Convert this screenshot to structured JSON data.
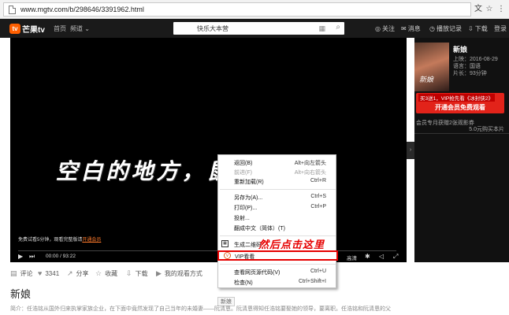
{
  "browser": {
    "url": "www.mgtv.com/b/298646/3391962.html"
  },
  "site": {
    "logo_text": "芒果tv",
    "logo_mark": "tv",
    "nav_home": "首页",
    "nav_channel": "频道",
    "search_value": "快乐大本营",
    "follow": "关注",
    "messages": "消息",
    "history": "播放记录",
    "download": "下载",
    "login": "登录"
  },
  "player": {
    "slogan": "空白的地方，鼠標右鍵！",
    "trial_text": "免费试看5分钟，观看完整版请",
    "trial_link": "开通会员",
    "time": "00:00 / 93:22",
    "quality": "高清"
  },
  "movie": {
    "poster_text": "新娘",
    "title": "新娘",
    "date": "上映：2016-08-29",
    "language": "语言：国语",
    "duration": "片长：93分钟",
    "promo_top": "买3送1，VIP抢先看《冰封侠2》",
    "promo_button": "开通会员免费观看",
    "vip_line": "会员专月获赠2张观影券",
    "price": "5.0元购买本片"
  },
  "toolbar": {
    "comment": "评论",
    "likes": "3341",
    "share": "分享",
    "favorite": "收藏",
    "download": "下载",
    "mode": "我的观看方式"
  },
  "page": {
    "title": "新娘",
    "intro": "简介：任浩铭从国外归来执掌家族企业，在下面中竟然发现了自己当年的未婚妻——阮清恩。阮清恩得知任浩铭要娶她的领导，要离职。任浩铭和阮清恩的父",
    "tag": "新娘"
  },
  "context_menu": {
    "items": [
      {
        "label": "返回(B)",
        "shortcut": "Alt+向左箭头",
        "disabled": false
      },
      {
        "label": "前进(F)",
        "shortcut": "Alt+向右箭头",
        "disabled": true
      },
      {
        "label": "重新加载(R)",
        "shortcut": "Ctrl+R",
        "disabled": false
      },
      {
        "label": "另存为(A)...",
        "shortcut": "Ctrl+S",
        "disabled": false
      },
      {
        "label": "打印(P)...",
        "shortcut": "Ctrl+P",
        "disabled": false
      },
      {
        "label": "投射...",
        "shortcut": "",
        "disabled": false
      },
      {
        "label": "翻成中文（简体）(T)",
        "shortcut": "",
        "disabled": false
      },
      {
        "label": "生成二维码",
        "shortcut": "",
        "disabled": false
      },
      {
        "label": "VIP看看",
        "shortcut": "",
        "disabled": false
      },
      {
        "label": "查看网页源代码(V)",
        "shortcut": "Ctrl+U",
        "disabled": false
      },
      {
        "label": "检查(N)",
        "shortcut": "Ctrl+Shift+I",
        "disabled": false
      }
    ],
    "annotation": "然后点击这里"
  },
  "colors": {
    "accent": "#ff5f00",
    "highlight": "#e60000"
  }
}
